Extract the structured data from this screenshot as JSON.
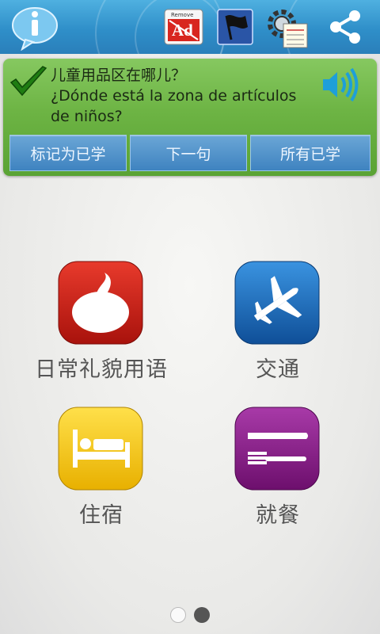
{
  "toolbar": {
    "ad_badge_text": "Remove",
    "ad_text": "Ad"
  },
  "phrase": {
    "chinese": "儿童用品区在哪儿？",
    "spanish": "¿Dónde está la zona de artículos de niños?"
  },
  "card_buttons": {
    "mark_learned": "标记为已学",
    "next_sentence": "下一句",
    "all_learned": "所有已学"
  },
  "categories": [
    {
      "label": "日常礼貌用语",
      "icon": "speech-bubble-icon",
      "color": "#d6221b"
    },
    {
      "label": "交通",
      "icon": "airplane-icon",
      "color": "#1c73c4"
    },
    {
      "label": "住宿",
      "icon": "bed-icon",
      "color": "#f2c300"
    },
    {
      "label": "就餐",
      "icon": "knife-fork-icon",
      "color": "#8a1c8a"
    }
  ],
  "pager": {
    "current": 1,
    "total": 2
  },
  "colors": {
    "toolbar": "#2f8fc9",
    "card": "#6db444",
    "card_button": "#3f83c0"
  }
}
